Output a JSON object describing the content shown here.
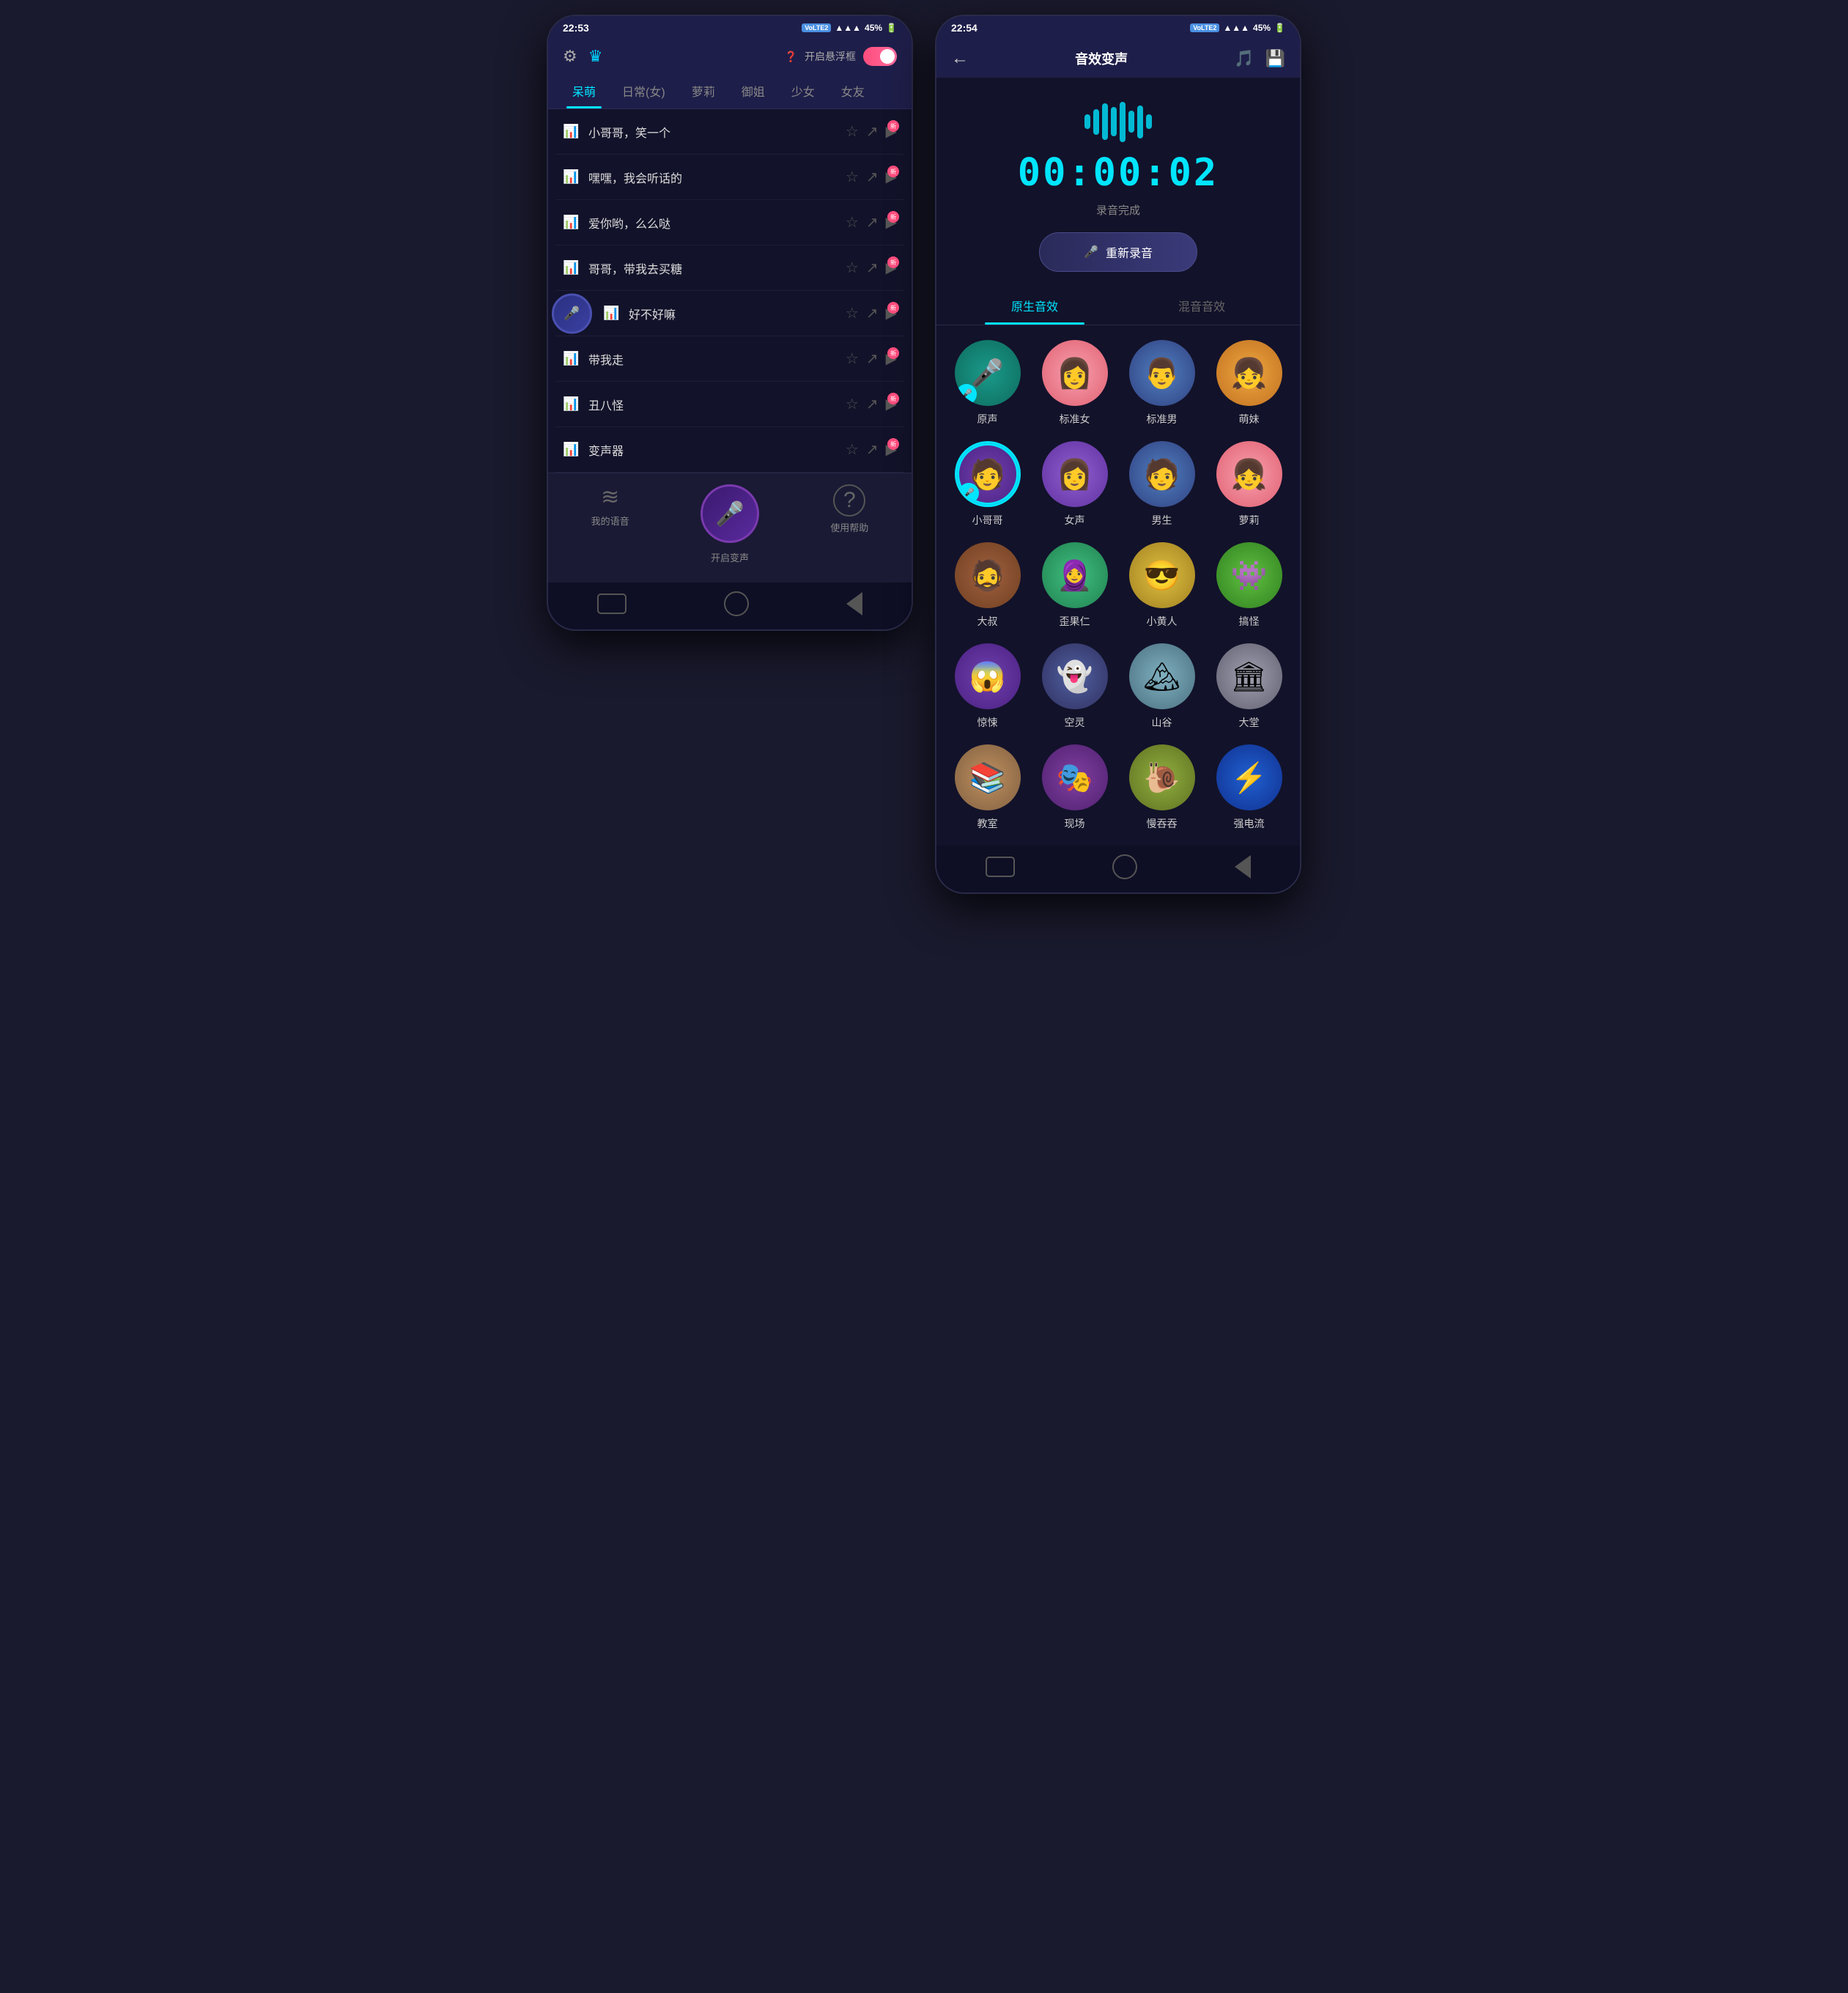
{
  "phone1": {
    "status": {
      "time": "22:53",
      "signal": "VoLTE2",
      "battery": "45%"
    },
    "header": {
      "floating_label": "开启悬浮框",
      "toggle_on": true
    },
    "tabs": [
      {
        "label": "呆萌",
        "active": true
      },
      {
        "label": "日常(女)",
        "active": false
      },
      {
        "label": "萝莉",
        "active": false
      },
      {
        "label": "御姐",
        "active": false
      },
      {
        "label": "少女",
        "active": false
      },
      {
        "label": "女友",
        "active": false
      }
    ],
    "voice_items": [
      {
        "name": "小哥哥，笑一个",
        "is_new": true
      },
      {
        "name": "嘿嘿，我会听话的",
        "is_new": true
      },
      {
        "name": "爱你哟，么么哒",
        "is_new": true
      },
      {
        "name": "哥哥，带我去买糖",
        "is_new": true
      },
      {
        "name": "好不好嘛",
        "is_new": true
      },
      {
        "name": "带我走",
        "is_new": true
      },
      {
        "name": "丑八怪",
        "is_new": true
      },
      {
        "name": "变声器",
        "is_new": true
      }
    ],
    "bottom_nav": {
      "items": [
        {
          "icon": "waveform",
          "label": "我的语音"
        },
        {
          "icon": "mic",
          "label": "开启变声"
        },
        {
          "icon": "question",
          "label": "使用帮助"
        }
      ]
    }
  },
  "phone2": {
    "status": {
      "time": "22:54",
      "signal": "VoLTE2",
      "battery": "45%"
    },
    "header": {
      "back": "←",
      "title": "音效变声"
    },
    "timer": "00:00:02",
    "recording_status": "录音完成",
    "re_record_btn": "重新录音",
    "effects_tabs": [
      {
        "label": "原生音效",
        "active": true
      },
      {
        "label": "混音音效",
        "active": false
      }
    ],
    "effects": [
      {
        "name": "原声",
        "emoji": "🎤",
        "color": "av-teal",
        "selected": false
      },
      {
        "name": "标准女",
        "emoji": "👩",
        "color": "av-pink",
        "selected": false
      },
      {
        "name": "标准男",
        "emoji": "👨",
        "color": "av-blue",
        "selected": false
      },
      {
        "name": "萌妹",
        "emoji": "👧",
        "color": "av-orange",
        "selected": false
      },
      {
        "name": "小哥哥",
        "emoji": "🧑",
        "color": "av-purple",
        "selected": true
      },
      {
        "name": "女声",
        "emoji": "👩",
        "color": "av-lavender",
        "selected": false
      },
      {
        "name": "男生",
        "emoji": "🧑",
        "color": "av-blue",
        "selected": false
      },
      {
        "name": "萝莉",
        "emoji": "👧",
        "color": "av-pink",
        "selected": false
      },
      {
        "name": "大叔",
        "emoji": "🧔",
        "color": "av-brown",
        "selected": false
      },
      {
        "name": "歪果仁",
        "emoji": "🧕",
        "color": "av-green",
        "selected": false
      },
      {
        "name": "小黄人",
        "emoji": "😎",
        "color": "av-yellow",
        "selected": false
      },
      {
        "name": "搞怪",
        "emoji": "👾",
        "color": "av-monster",
        "selected": false
      },
      {
        "name": "惊悚",
        "emoji": "😱",
        "color": "av-purple",
        "selected": false
      },
      {
        "name": "空灵",
        "emoji": "👻",
        "color": "av-ghost",
        "selected": false
      },
      {
        "name": "山谷",
        "emoji": "🏔",
        "color": "av-nature",
        "selected": false
      },
      {
        "name": "大堂",
        "emoji": "🏛",
        "color": "av-hall",
        "selected": false
      },
      {
        "name": "教室",
        "emoji": "📚",
        "color": "av-class",
        "selected": false
      },
      {
        "name": "现场",
        "emoji": "🎭",
        "color": "av-live",
        "selected": false
      },
      {
        "name": "慢吞吞",
        "emoji": "🐌",
        "color": "av-snail",
        "selected": false
      },
      {
        "name": "强电流",
        "emoji": "⚡",
        "color": "av-electric",
        "selected": false
      }
    ]
  }
}
